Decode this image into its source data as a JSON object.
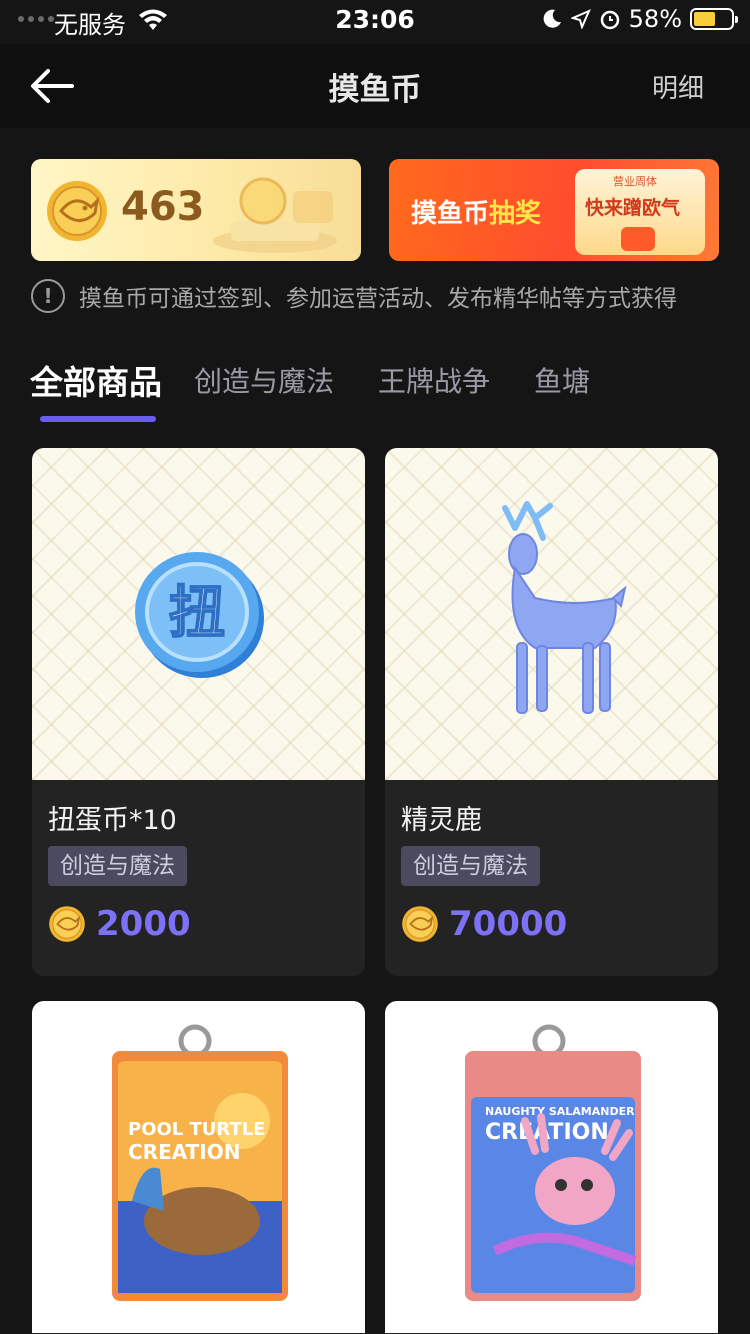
{
  "status_bar": {
    "carrier": "无服务",
    "time": "23:06",
    "battery": "58%"
  },
  "nav": {
    "title": "摸鱼币",
    "detail": "明细"
  },
  "balance": {
    "value": "463"
  },
  "lottery": {
    "title_part1": "摸鱼币",
    "title_part2": "抽奖",
    "badge_small": "营业周体",
    "cta": "快来蹭欧气"
  },
  "notice": "摸鱼币可通过签到、参加运营活动、发布精华帖等方式获得",
  "tabs": [
    {
      "label": "全部商品",
      "active": true
    },
    {
      "label": "创造与魔法"
    },
    {
      "label": "王牌战争"
    },
    {
      "label": "鱼塘"
    }
  ],
  "products": [
    {
      "name": "扭蛋币*10",
      "tag": "创造与魔法",
      "price": "2000",
      "icon": "gacha-coin-icon",
      "coin_glyph": "扭"
    },
    {
      "name": "精灵鹿",
      "tag": "创造与魔法",
      "price": "70000",
      "icon": "spirit-deer-image"
    },
    {
      "name": "",
      "tag": "",
      "price": "",
      "icon": "card-holder-turtle-image",
      "print": [
        "POOL TURTLE",
        "CREATION"
      ]
    },
    {
      "name": "",
      "tag": "",
      "price": "",
      "icon": "card-holder-salamander-image",
      "print": [
        "NAUGHTY SALAMANDER",
        "CREATION"
      ]
    }
  ],
  "colors": {
    "accent": "#6a5ef2",
    "price": "#7d72f5",
    "background": "#151515"
  }
}
